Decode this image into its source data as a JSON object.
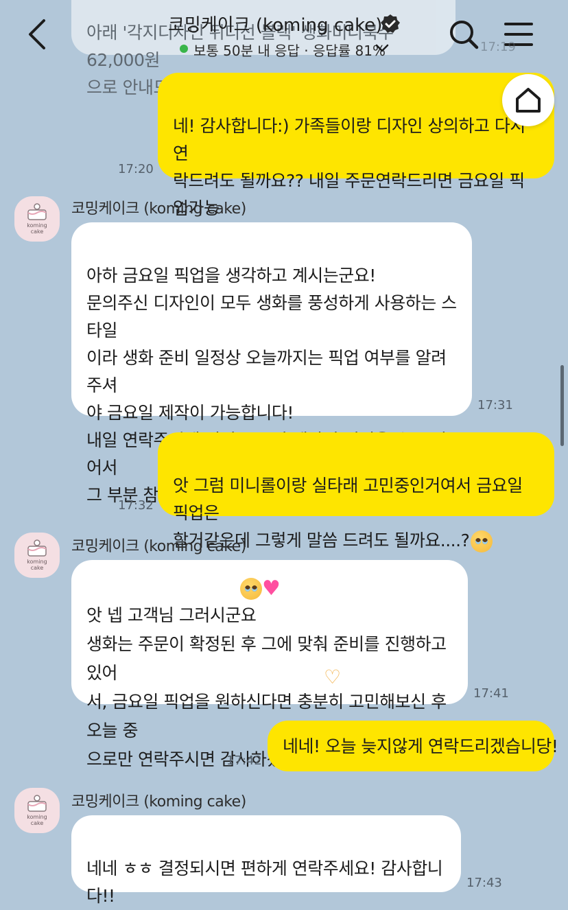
{
  "header": {
    "title": "코밍케이크 (koming cake)",
    "status": "보통 50분 내 응답 · 응답률 81%"
  },
  "top_partial_bubble": {
    "text": "아래 '각지디자인 뒤디선 블랙' 생화미니북수 62,000원\n으로 안내드립니다!",
    "time": "17:19"
  },
  "messages": [
    {
      "dir": "out",
      "text": "네! 감사합니다:) 가족들이랑 디자인 상의하고 다시 연\n락드려도 될까요?? 내일 주문연락드리면 금요일 픽업가능\n할까용??",
      "time": "17:20"
    },
    {
      "dir": "in",
      "sender": "코밍케이크 (koming cake)",
      "text": "아하 금요일 픽업을 생각하고 계시는군요!\n문의주신 디자인이 모두 생화를 풍성하게 사용하는 스타일\n이라 생화 준비 일정상 오늘까지는 픽업 여부를 알려주셔\n야 금요일 제작이 가능합니다!\n내일 연락주시게 되면 금요일 제작이 어려울 수도 있어서\n그 부분 참고 부탁드립니다 !",
      "time": "17:31"
    },
    {
      "dir": "out",
      "text": "앗 그럼 미니롤이랑 실타래 고민중인거여서 금요일 픽업은\n할거같은데 그렇게 말씀 드려도 될까요....?",
      "time": "17:32"
    },
    {
      "dir": "in",
      "sender": "코밍케이크 (koming cake)",
      "text": "앗 넵 고객님 그러시군요\n생화는 주문이 확정된 후 그에 맞춰 준비를 진행하고 있어\n서, 금요일 픽업을 원하신다면 충분히 고민해보신 후 오늘 중\n으로만 연락주시면 감사하겠습니다!",
      "time": "17:41"
    },
    {
      "dir": "out",
      "text": "네네! 오늘 늦지않게 연락드리겠습니당!",
      "time": "17:42"
    },
    {
      "dir": "in",
      "sender": "코밍케이크 (koming cake)",
      "text": "네네 ㅎㅎ 결정되시면 편하게 연락주세요! 감사합니\n다!!",
      "time": "17:43"
    }
  ],
  "avatar_text": "koming\ncake",
  "colors": {
    "background": "#b2c7d9",
    "outgoing_bubble": "#fee500",
    "incoming_bubble": "#ffffff",
    "online_dot": "#39b54a"
  },
  "icons": [
    "back-arrow-icon",
    "verified-badge-icon",
    "chevron-down-icon",
    "search-icon",
    "menu-icon",
    "home-icon"
  ]
}
